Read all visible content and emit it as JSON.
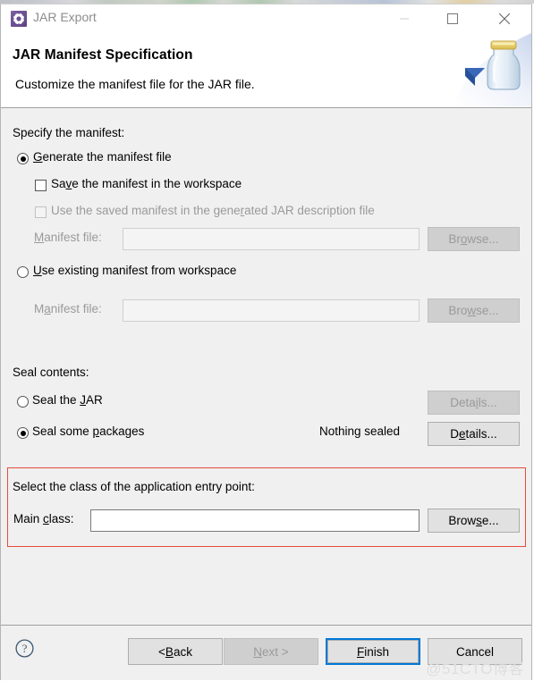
{
  "window": {
    "title": "JAR Export",
    "icon": "gear-icon",
    "controls": {
      "minimize": "minimize-icon",
      "maximize": "maximize-icon",
      "close": "close-icon"
    }
  },
  "header": {
    "title": "JAR Manifest Specification",
    "subtitle": "Customize the manifest file for the JAR file.",
    "art": "jar-bottle-icon"
  },
  "manifest_section": {
    "label": "Specify the manifest:",
    "generate_radio": {
      "label_pre": "G",
      "label_post": "enerate the manifest file",
      "checked": true
    },
    "save_checkbox": {
      "label_pre": "Sa",
      "label_mid": "v",
      "label_post": "e the manifest in the workspace",
      "checked": false,
      "disabled": false
    },
    "use_saved_checkbox": {
      "label_pre": "Use the saved manifest in the gene",
      "label_mid": "r",
      "label_post": "ated JAR description file",
      "checked": false,
      "disabled": true
    },
    "generate_file": {
      "label_pre": "M",
      "label_post": "anifest file:",
      "value": "",
      "placeholder": "",
      "disabled": true,
      "browse_pre": "Br",
      "browse_mid": "o",
      "browse_post": "wse..."
    },
    "use_existing_radio": {
      "label_pre": "U",
      "label_post": "se existing manifest from workspace",
      "checked": false
    },
    "existing_file": {
      "label_pre": "M",
      "label_mid": "a",
      "label_post": "nifest file:",
      "value": "",
      "placeholder": "",
      "disabled": true,
      "browse_pre": "Bro",
      "browse_mid": "w",
      "browse_post": "se..."
    }
  },
  "seal_section": {
    "label": "Seal contents:",
    "seal_jar_radio": {
      "label_pre": "Seal the ",
      "label_mid": "J",
      "label_post": "AR",
      "checked": false
    },
    "seal_jar_details": {
      "pre": "Deta",
      "mid": "i",
      "post": "ls...",
      "disabled": true
    },
    "seal_packages_radio": {
      "label_pre": "Seal some ",
      "label_mid": "p",
      "label_post": "ackages",
      "checked": true
    },
    "seal_status": "Nothing sealed",
    "seal_packages_details": {
      "pre": "D",
      "mid": "e",
      "post": "tails...",
      "disabled": false
    }
  },
  "entry_point_section": {
    "label": "Select the class of the application entry point:",
    "main_class": {
      "label_pre": "Main ",
      "label_mid": "c",
      "label_post": "lass:",
      "value": "",
      "placeholder": "",
      "disabled": false
    },
    "browse": {
      "pre": "Brow",
      "mid": "s",
      "post": "e...",
      "disabled": false
    },
    "annotation_color": "#e74b3c"
  },
  "footer": {
    "help": "help-icon",
    "back": {
      "pre": "< ",
      "mid": "B",
      "post": "ack",
      "disabled": false
    },
    "next": {
      "pre": "",
      "mid": "N",
      "post": "ext >",
      "disabled": true
    },
    "finish": {
      "pre": "",
      "mid": "F",
      "post": "inish",
      "disabled": false,
      "default": true
    },
    "cancel": {
      "pre": "Cancel",
      "mid": "",
      "post": "",
      "disabled": false
    }
  },
  "watermark": "@51CTO博客",
  "colors": {
    "accent": "#0078d7",
    "annotation": "#e74b3c",
    "dialog_bg": "#f0f0f0",
    "header_bg": "#ffffff"
  }
}
